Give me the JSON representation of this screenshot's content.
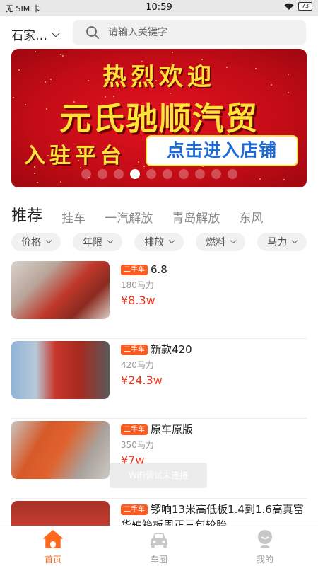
{
  "status_bar": {
    "carrier": "无 SIM 卡",
    "time": "10:59",
    "battery": "73"
  },
  "header": {
    "city": "石家…",
    "search_placeholder": "请输入关键字"
  },
  "banner": {
    "line1": "热烈欢迎",
    "line2": "元氏驰顺汽贸",
    "line3": "入驻平台",
    "button": "点击进入店铺",
    "dot_count": 10,
    "active_dot": 3
  },
  "tabs": [
    "推荐",
    "挂车",
    "一汽解放",
    "青岛解放",
    "东风"
  ],
  "filters": [
    "价格",
    "年限",
    "排放",
    "燃料",
    "马力"
  ],
  "listings": [
    {
      "tag": "二手车",
      "title": "6.8",
      "power": "180马力",
      "price": "¥8.3w"
    },
    {
      "tag": "二手车",
      "title": "新款420",
      "power": "420马力",
      "price": "¥24.3w"
    },
    {
      "tag": "二手车",
      "title": "原车原版",
      "power": "350马力",
      "price": "¥7w"
    },
    {
      "tag": "二手车",
      "title": "锣响13米高低板1.4到1.6高真富华轴箱板周正三包轮胎",
      "power": "",
      "price": ""
    }
  ],
  "toast": "WiFi调试未连接",
  "bottom_nav": [
    {
      "label": "首页",
      "icon": "home-icon",
      "active": true
    },
    {
      "label": "车圈",
      "icon": "car-icon",
      "active": false
    },
    {
      "label": "我的",
      "icon": "profile-icon",
      "active": false
    }
  ],
  "colors": {
    "accent": "#ff6a1f",
    "price": "#f1341d",
    "banner_red": "#d0101b",
    "banner_text": "#ffe23a",
    "banner_button_text": "#1d6bd6"
  }
}
